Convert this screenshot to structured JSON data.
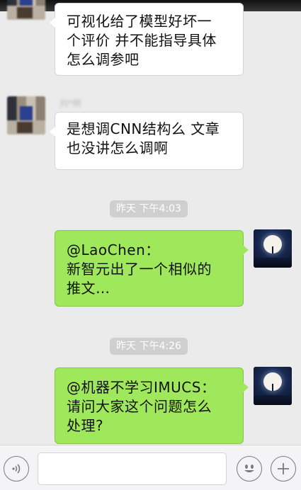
{
  "messages": [
    {
      "side": "left",
      "lines": [
        "可视化给了模型好坏一",
        "个评价  并不能指导具体",
        "怎么调参吧"
      ]
    },
    {
      "side": "left",
      "sender": "刘*明",
      "lines": [
        "是想调CNN结构么 文章",
        "也没讲怎么调啊"
      ]
    },
    {
      "side": "right",
      "timestamp": "昨天 下午4:03",
      "lines": [
        "@LaoChen：",
        "新智元出了一个相似的",
        "推文…"
      ]
    },
    {
      "side": "right",
      "timestamp": "昨天 下午4:26",
      "lines": [
        "@机器不学习IMUCS：",
        "请问大家这个问题怎么",
        "处理?"
      ]
    }
  ],
  "input_bar": {
    "voice_icon": "voice-icon",
    "emoji_icon": "emoji-icon",
    "plus_icon": "plus-icon",
    "text_value": ""
  },
  "colors": {
    "background": "#ebebeb",
    "bubble_self": "#9fe85b",
    "bubble_other": "#ffffff",
    "timestamp_bg": "#cfcfcf"
  }
}
